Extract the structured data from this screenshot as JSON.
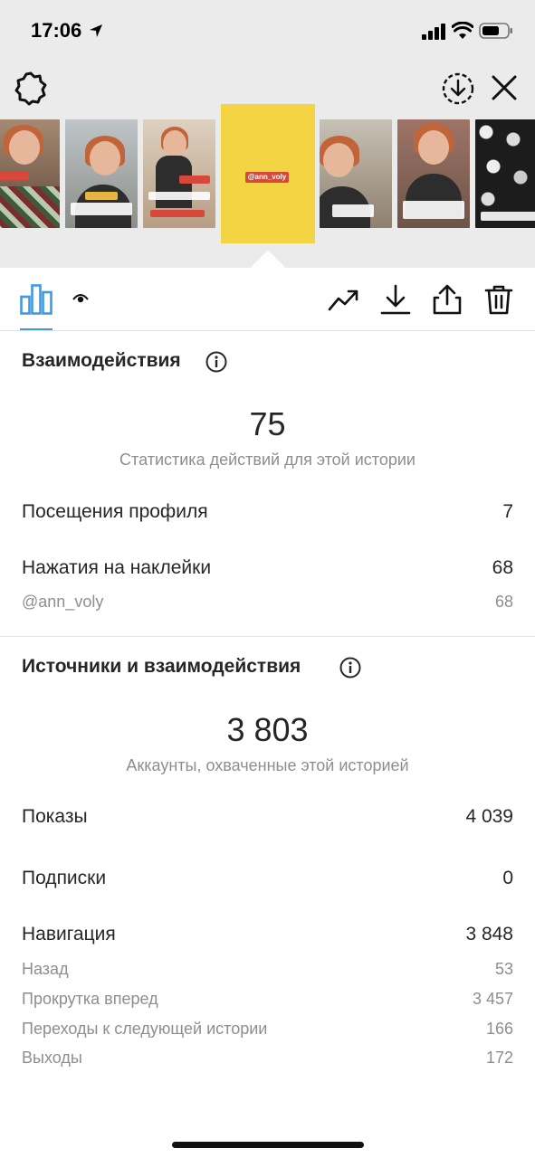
{
  "status": {
    "time": "17:06"
  },
  "story_toolbar": {
    "settings_icon": "gear-icon",
    "save_icon": "download-circle-icon",
    "close_icon": "close-icon"
  },
  "thumbnails": {
    "selected_sticker": "@ann_voly"
  },
  "tabs": [
    {
      "icon": "bar-chart-icon",
      "active": true
    },
    {
      "icon": "eye-icon",
      "active": false
    }
  ],
  "actions": [
    {
      "icon": "trend-icon"
    },
    {
      "icon": "download-icon"
    },
    {
      "icon": "share-icon"
    },
    {
      "icon": "trash-icon"
    }
  ],
  "interactions": {
    "title": "Взаимодействия",
    "total": "75",
    "total_caption": "Статистика действий для этой истории",
    "rows": [
      {
        "label": "Посещения профиля",
        "value": "7"
      },
      {
        "label": "Нажатия на наклейки",
        "value": "68"
      }
    ],
    "sub_rows": [
      {
        "label": "@ann_voly",
        "value": "68"
      }
    ]
  },
  "discovery": {
    "title": "Источники и взаимодействия",
    "total": "3 803",
    "total_caption": "Аккаунты, охваченные этой историей",
    "rows": [
      {
        "label": "Показы",
        "value": "4 039"
      },
      {
        "label": "Подписки",
        "value": "0"
      },
      {
        "label": "Навигация",
        "value": "3 848"
      }
    ],
    "navigation": [
      {
        "label": "Назад",
        "value": "53"
      },
      {
        "label": "Прокрутка вперед",
        "value": "3 457"
      },
      {
        "label": "Переходы к следующей истории",
        "value": "166"
      },
      {
        "label": "Выходы",
        "value": "172"
      }
    ]
  },
  "colors": {
    "accent": "#3f9ae2",
    "selected_story": "#f3d544",
    "sticker": "#d8483a",
    "muted_text": "#8e8e8e"
  }
}
